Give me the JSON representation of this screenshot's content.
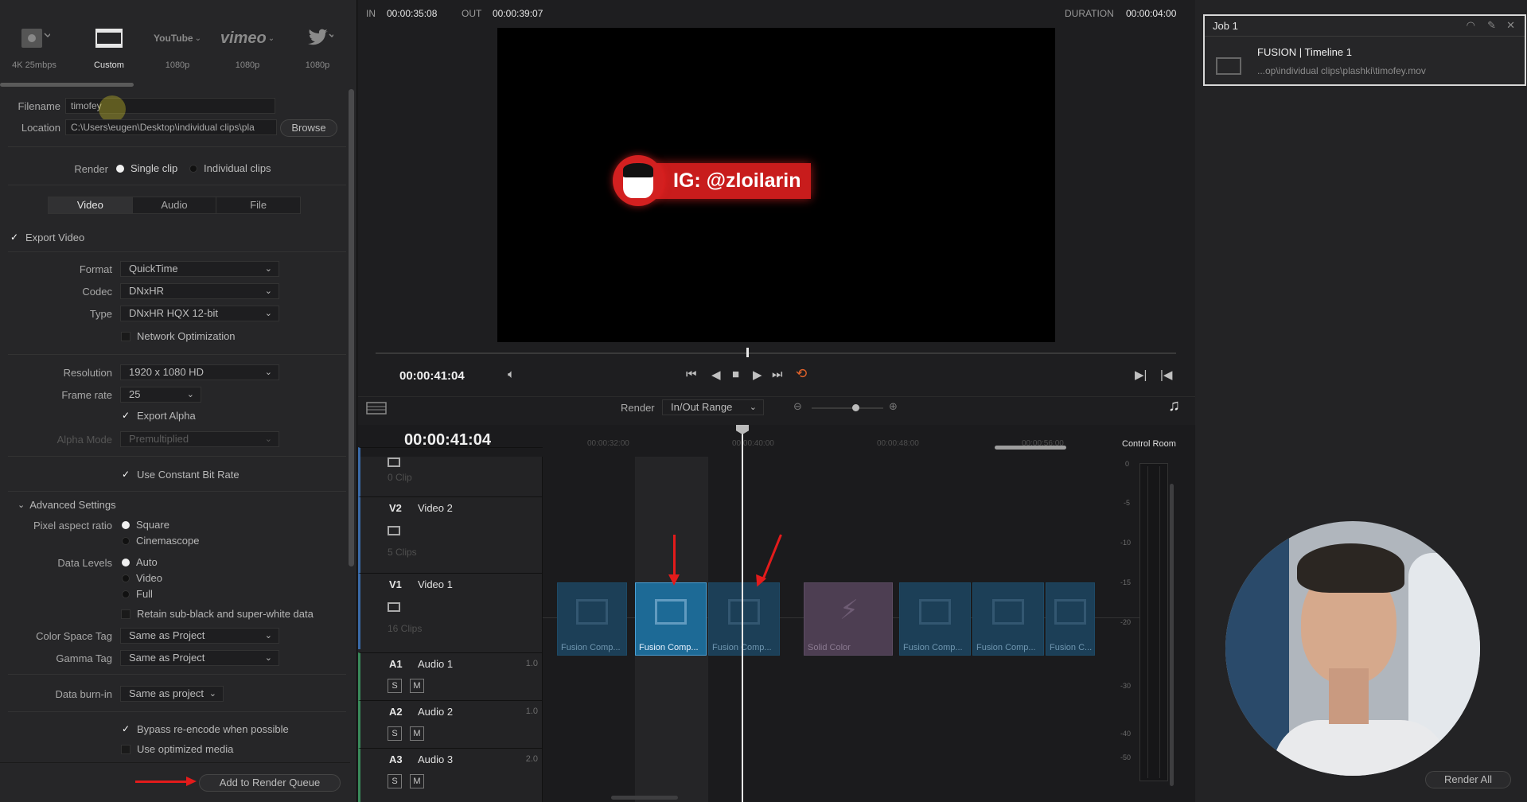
{
  "presets": [
    {
      "label": "4K 25mbps",
      "icon": "render-preset-icon"
    },
    {
      "label": "Custom",
      "icon": "film-icon"
    },
    {
      "label": "1080p",
      "icon": "youtube-logo",
      "brand": "YouTube"
    },
    {
      "label": "1080p",
      "icon": "vimeo-logo",
      "brand": "vimeo"
    },
    {
      "label": "1080p",
      "icon": "twitter-icon"
    }
  ],
  "file": {
    "filename_label": "Filename",
    "filename_value": "timofey",
    "location_label": "Location",
    "location_value": "C:\\Users\\eugen\\Desktop\\individual clips\\pla",
    "browse": "Browse"
  },
  "render_mode": {
    "label": "Render",
    "options": [
      "Single clip",
      "Individual clips"
    ],
    "selected": "Single clip"
  },
  "tabs": [
    "Video",
    "Audio",
    "File"
  ],
  "active_tab": "Video",
  "video": {
    "export_video": "Export Video",
    "format_label": "Format",
    "format": "QuickTime",
    "codec_label": "Codec",
    "codec": "DNxHR",
    "type_label": "Type",
    "type": "DNxHR HQX 12-bit",
    "network_opt": "Network Optimization",
    "resolution_label": "Resolution",
    "resolution": "1920 x 1080 HD",
    "framerate_label": "Frame rate",
    "framerate": "25",
    "export_alpha": "Export Alpha",
    "alpha_mode_label": "Alpha Mode",
    "alpha_mode": "Premultiplied",
    "constant_bitrate": "Use Constant Bit Rate"
  },
  "advanced": {
    "title": "Advanced Settings",
    "pixel_aspect_label": "Pixel aspect ratio",
    "pixel_aspect_options": [
      "Square",
      "Cinemascope"
    ],
    "data_levels_label": "Data Levels",
    "data_levels_options": [
      "Auto",
      "Video",
      "Full"
    ],
    "retain": "Retain sub-black and super-white data",
    "color_space_label": "Color Space Tag",
    "color_space": "Same as Project",
    "gamma_label": "Gamma Tag",
    "gamma": "Same as Project",
    "burnin_label": "Data burn-in",
    "burnin": "Same as project",
    "bypass": "Bypass re-encode when possible",
    "optimized": "Use optimized media",
    "add_queue": "Add to Render Queue"
  },
  "viewer": {
    "in_label": "IN",
    "in": "00:00:35:08",
    "out_label": "OUT",
    "out": "00:00:39:07",
    "duration_label": "DURATION",
    "duration": "00:00:04:00",
    "overlay_text": "IG: @zloilarin",
    "timecode": "00:00:41:04"
  },
  "toolbar": {
    "render_label": "Render",
    "render_range": "In/Out Range"
  },
  "timeline": {
    "timecode": "00:00:41:04",
    "ruler": [
      "00:00:32:00",
      "00:00:40:00",
      "00:00:48:00",
      "00:00:56:00"
    ],
    "tracks": [
      {
        "id": "",
        "name": "",
        "count": "0 Clip"
      },
      {
        "id": "V2",
        "name": "Video 2",
        "count": "5 Clips"
      },
      {
        "id": "V1",
        "name": "Video 1",
        "count": "16 Clips"
      },
      {
        "id": "A1",
        "name": "Audio 1",
        "vol": "1.0"
      },
      {
        "id": "A2",
        "name": "Audio 2",
        "vol": "1.0"
      },
      {
        "id": "A3",
        "name": "Audio 3",
        "vol": "2.0"
      }
    ],
    "solo": "S",
    "mute": "M",
    "clips": [
      "Fusion Comp...",
      "Fusion Comp...",
      "Fusion Comp...",
      "Solid Color",
      "Fusion Comp...",
      "Fusion Comp...",
      "Fusion C..."
    ]
  },
  "queue": {
    "job": "Job 1",
    "title": "FUSION | Timeline 1",
    "path": "...op\\individual clips\\plashki\\timofey.mov",
    "render_all": "Render All"
  },
  "meter": {
    "label": "Control Room",
    "ticks": [
      "0",
      "-5",
      "-10",
      "-15",
      "-20",
      "-30",
      "-40",
      "-50"
    ]
  },
  "colors": {
    "accent": "#1d6a96",
    "arrow": "#e31b1b",
    "overlay_red": "#c81c1c",
    "loop": "#e0622a"
  }
}
